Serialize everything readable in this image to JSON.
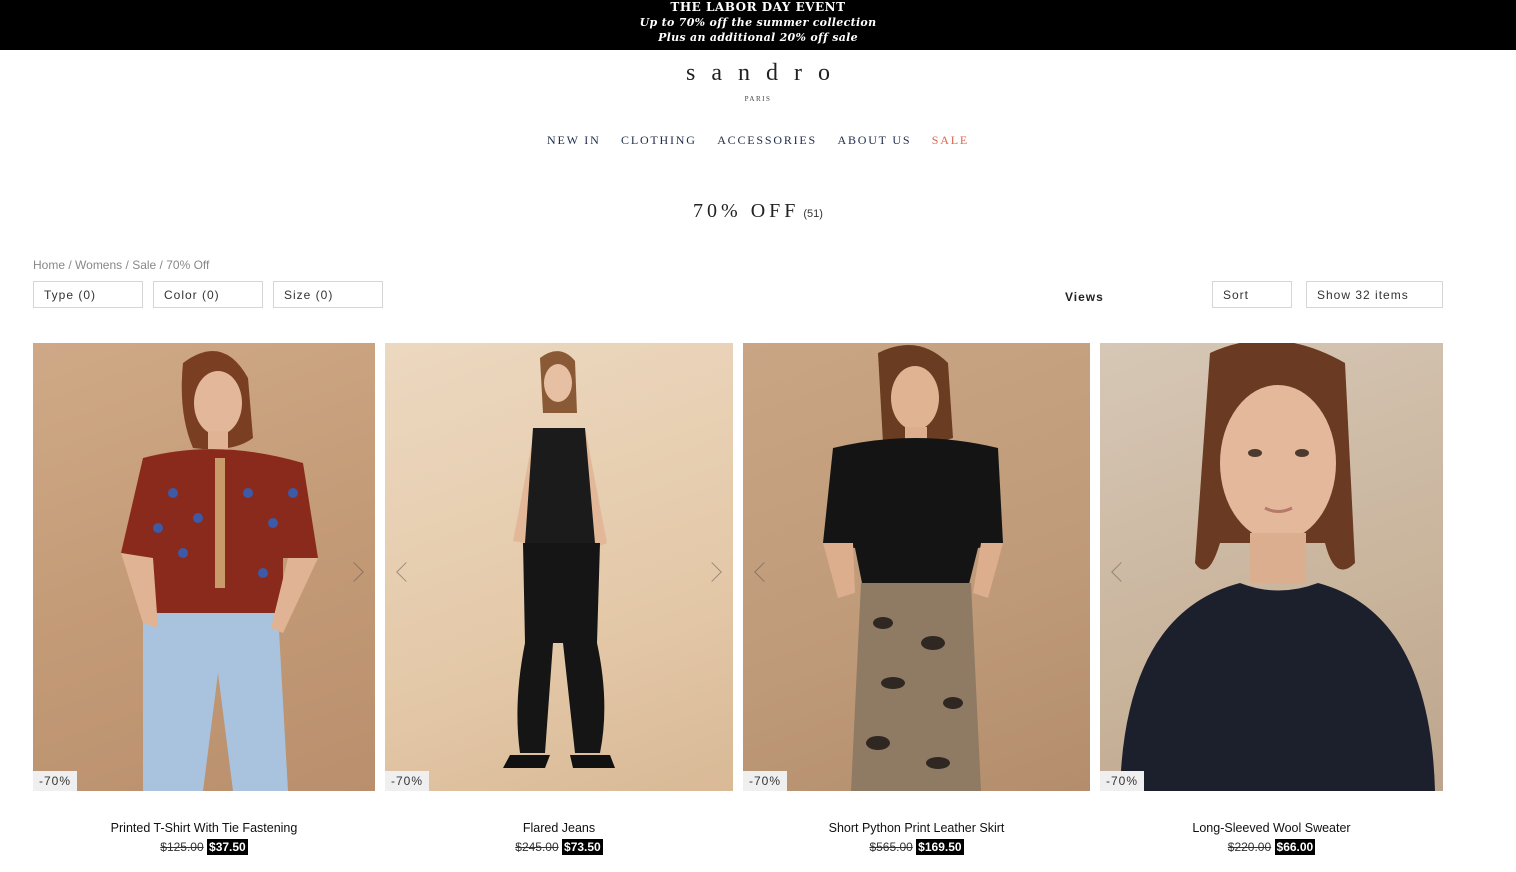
{
  "promo": {
    "line1": "THE LABOR DAY EVENT",
    "line2": "Up to 70% off the summer collection",
    "line3": "Plus an additional 20% off sale"
  },
  "logo": {
    "brand": "sandro",
    "city": "PARIS"
  },
  "nav": {
    "items": [
      {
        "label": "NEW IN"
      },
      {
        "label": "CLOTHING"
      },
      {
        "label": "ACCESSORIES"
      },
      {
        "label": "ABOUT US"
      },
      {
        "label": "SALE",
        "color": "#e0644d"
      }
    ]
  },
  "page": {
    "title": "70% OFF",
    "count": "(51)"
  },
  "breadcrumb": [
    "Home",
    "Womens",
    "Sale",
    "70% Off"
  ],
  "filters": {
    "type": "Type (0)",
    "color": "Color (0)",
    "size": "Size (0)",
    "views": "Views",
    "sort": "Sort",
    "show": "Show 32 items"
  },
  "products": [
    {
      "name": "Printed T-Shirt With Tie Fastening",
      "old_price": "$125.00",
      "new_price": "$37.50",
      "badge": "-70%"
    },
    {
      "name": "Flared Jeans",
      "old_price": "$245.00",
      "new_price": "$73.50",
      "badge": "-70%"
    },
    {
      "name": "Short Python Print Leather Skirt",
      "old_price": "$565.00",
      "new_price": "$169.50",
      "badge": "-70%"
    },
    {
      "name": "Long-Sleeved Wool Sweater",
      "old_price": "$220.00",
      "new_price": "$66.00",
      "badge": "-70%"
    }
  ]
}
